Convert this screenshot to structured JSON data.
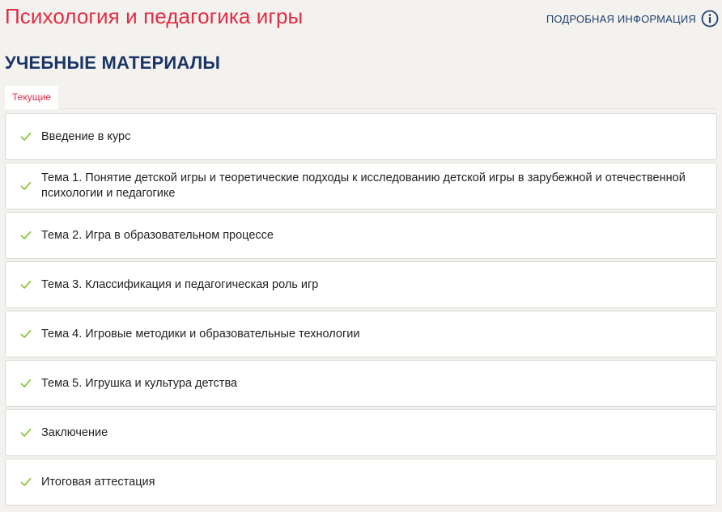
{
  "header": {
    "course_title": "Психология и педагогика игры",
    "info_link_label": "ПОДРОБНАЯ ИНФОРМАЦИЯ",
    "info_icon": "info-circle-icon"
  },
  "section": {
    "title": "УЧЕБНЫЕ МАТЕРИАЛЫ"
  },
  "tabs": [
    {
      "label": "Текущие",
      "active": true
    }
  ],
  "materials": [
    {
      "label": "Введение в курс",
      "completed": true
    },
    {
      "label": "Тема 1. Понятие детской игры и теоретические подходы к исследованию детской игры в зарубежной и отечественной психологии и педагогике",
      "completed": true
    },
    {
      "label": "Тема 2. Игра в образовательном процессе",
      "completed": true
    },
    {
      "label": "Тема 3. Классификация и педагогическая роль игр",
      "completed": true
    },
    {
      "label": "Тема 4. Игровые методики и образовательные технологии",
      "completed": true
    },
    {
      "label": "Тема 5. Игрушка и культура детства",
      "completed": true
    },
    {
      "label": "Заключение",
      "completed": true
    },
    {
      "label": "Итоговая аттестация",
      "completed": true
    }
  ],
  "colors": {
    "title_red": "#e32b44",
    "navy": "#1a3566",
    "link_blue": "#1f3f6e",
    "check_green": "#8cc63f",
    "background": "#f3f2ef"
  }
}
